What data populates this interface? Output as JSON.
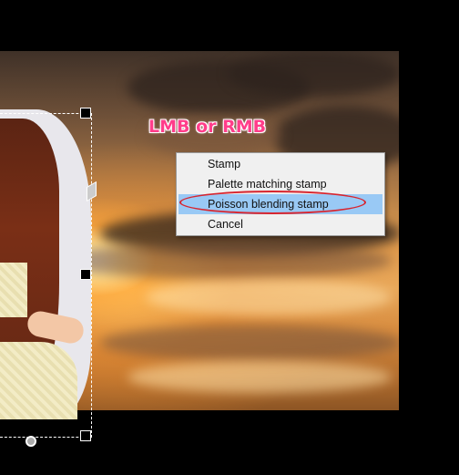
{
  "hint": {
    "text": "LMB or RMB",
    "color": "#ff3d8a"
  },
  "context_menu": {
    "items": [
      {
        "label": "Stamp"
      },
      {
        "label": "Palette matching stamp"
      },
      {
        "label": "Poisson blending stamp",
        "highlighted": true
      },
      {
        "label": "Cancel"
      }
    ],
    "highlight_color": "#99c9f5",
    "annotation_color": "#d8252f"
  },
  "canvas": {
    "background_color": "#000000",
    "photo_subject": "sunset-sky",
    "layer_subject": "doll"
  },
  "transform_handles": {
    "handle_color": "#000000",
    "border_color": "#ffffff"
  }
}
